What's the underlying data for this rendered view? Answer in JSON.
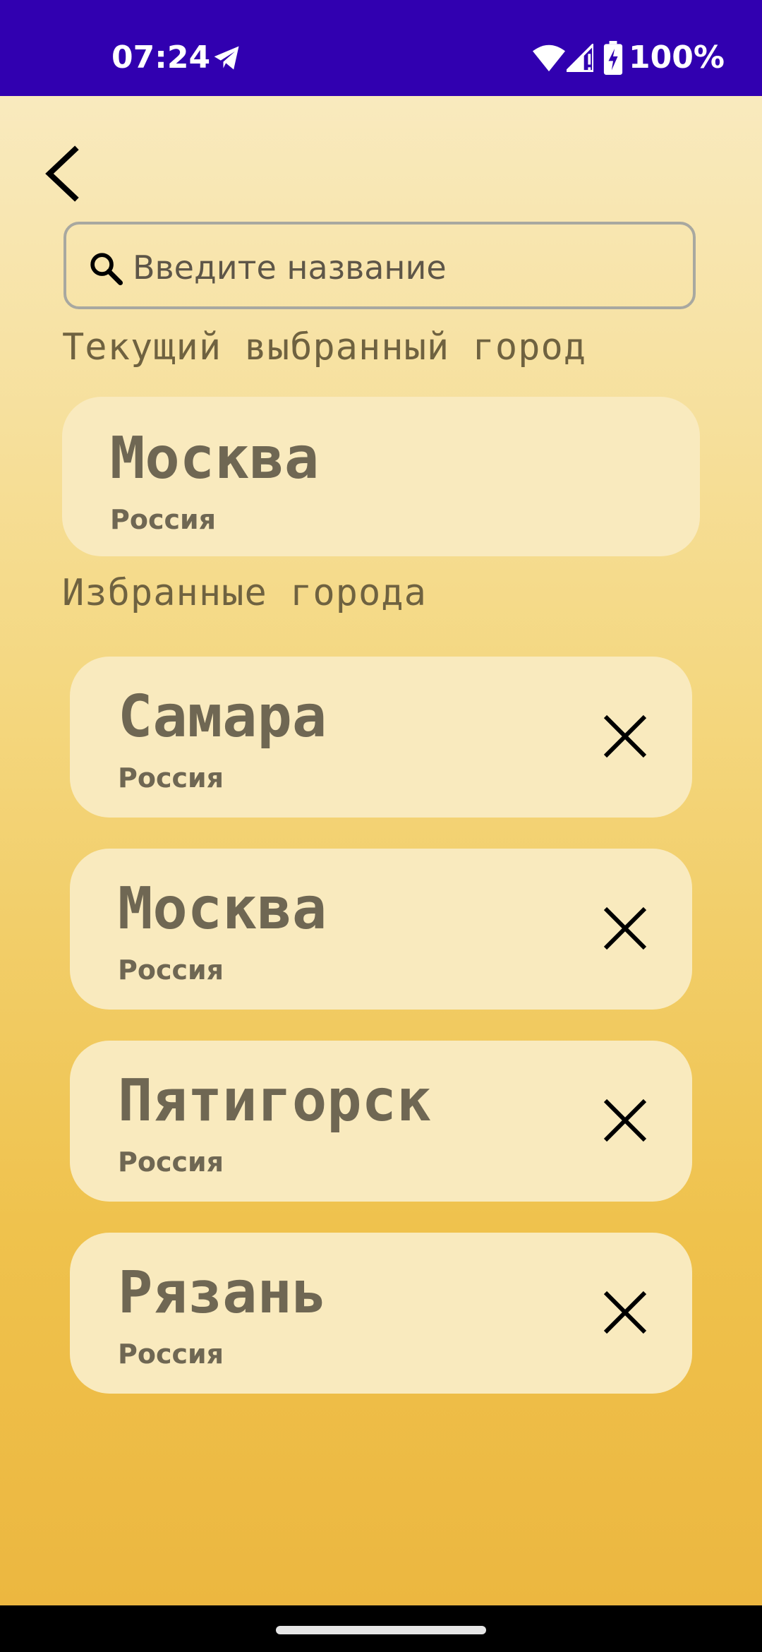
{
  "status_bar": {
    "time": "07:24",
    "battery": "100%",
    "icons": [
      "telegram-icon",
      "wifi-icon",
      "signal-icon",
      "battery-charging-icon"
    ],
    "background": "#3100b0"
  },
  "header": {
    "back_icon": "chevron-left-icon"
  },
  "search": {
    "placeholder": "Введите название",
    "value": ""
  },
  "current_city": {
    "section_title": "Текущий выбранный город",
    "name": "Москва",
    "country": "Россия"
  },
  "favorites": {
    "section_title": "Избранные города",
    "items": [
      {
        "name": "Самара",
        "country": "Россия"
      },
      {
        "name": "Москва",
        "country": "Россия"
      },
      {
        "name": "Пятигорск",
        "country": "Россия"
      },
      {
        "name": "Рязань",
        "country": "Россия"
      }
    ]
  },
  "colors": {
    "card": "#f9eabe",
    "text": "#6f6753",
    "gradient_top": "#f9eabe",
    "gradient_bottom": "#ecb740"
  }
}
